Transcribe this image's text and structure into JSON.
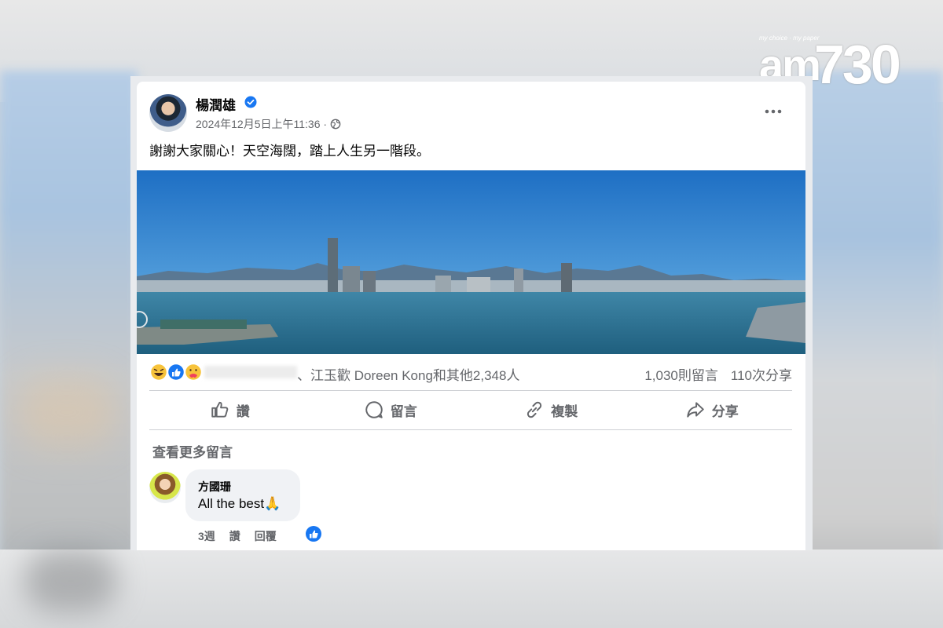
{
  "watermark": {
    "tagline": "my choice · my paper",
    "brand": "am",
    "number": "730"
  },
  "post": {
    "author": "楊潤雄",
    "verified": true,
    "timestamp": "2024年12月5日上午11:36 ·",
    "audience_icon": "globe-icon",
    "more_icon": "more-options-icon",
    "caption": "謝謝大家關心！天空海闊，踏上人生另一階段。",
    "photo_description_icon": "harbour-photo"
  },
  "stats": {
    "reaction_icons": [
      "haha-reaction-icon",
      "like-reaction-icon",
      "care-reaction-icon"
    ],
    "likers": "、江玉歡 Doreen Kong和其他2,348人",
    "comments": "1,030則留言",
    "shares": "110次分享"
  },
  "actions": {
    "like": "讚",
    "comment": "留言",
    "copy": "複製",
    "share": "分享"
  },
  "comments": {
    "view_more": "查看更多留言",
    "items": [
      {
        "author": "方國珊",
        "text": "All the best🙏",
        "time": "3週",
        "like": "讚",
        "reply": "回覆",
        "reaction_icon": "like-reaction-icon"
      }
    ]
  },
  "colors": {
    "facebook_blue": "#1877f2",
    "secondary_text": "#65676b",
    "primary_text": "#050505",
    "divider": "#ced0d4"
  }
}
